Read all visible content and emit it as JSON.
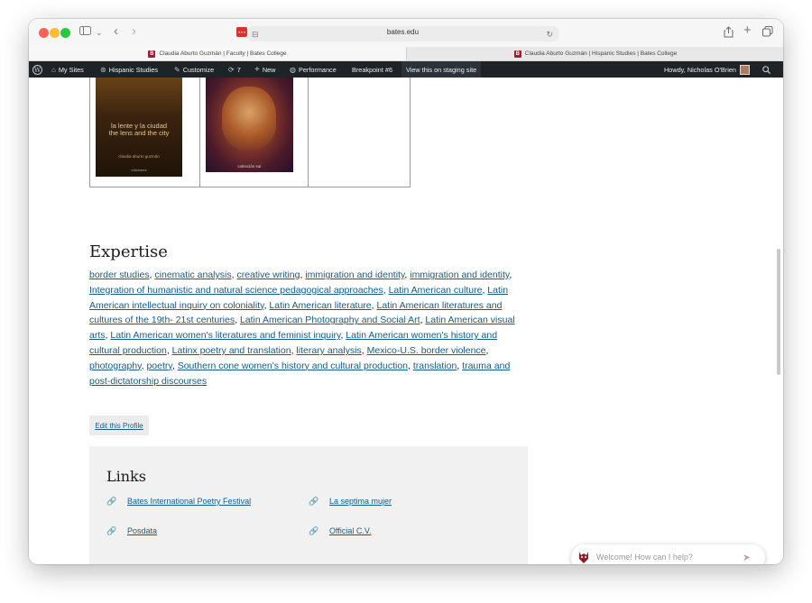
{
  "browser": {
    "url": "bates.edu",
    "tabs": [
      {
        "label": "Claudia Aburto Guzmán | Faculty | Bates College",
        "favicon": "B",
        "active": true
      },
      {
        "label": "Claudia Aburto Guzmán | Hispanic Studies | Bates College",
        "favicon": "B",
        "active": false
      }
    ],
    "icons": {
      "sidebar": "sidebar-icon",
      "back": "‹",
      "forward": "›",
      "share": "share-icon",
      "new_tab": "+",
      "tabs": "tabs-icon",
      "reload": "↻"
    }
  },
  "admin_bar": {
    "my_sites": "My Sites",
    "site_name": "Hispanic Studies",
    "customize": "Customize",
    "updates_count": "7",
    "new": "New",
    "performance": "Performance",
    "breakpoint": "Breakpoint #6",
    "staging": "View this on staging site",
    "howdy": "Howdy, Nicholas O'Brien"
  },
  "books": [
    {
      "title_es": "la lente y la ciudad",
      "title_en": "the lens and the city",
      "author": "claudia aburto guzmán",
      "publisher": "ediciones"
    },
    {
      "caption": "colección sur"
    }
  ],
  "expertise": {
    "heading": "Expertise",
    "tags": [
      "border studies",
      "cinematic analysis",
      "creative writing",
      "immigration and identity",
      "immigration and identity",
      "Integration of humanistic and natural science pedagogical approaches",
      "Latin American culture",
      "Latin American intellectual inquiry on coloniality",
      "Latin American literature",
      "Latin American literatures and cultures of the 19th- 21st centuries",
      "Latin American Photography and Social Art",
      "Latin American visual arts",
      "Latin American women's literatures and feminist inquiry",
      "Latin American women's history and cultural production",
      "Latinx poetry and translation",
      "literary analysis",
      "Mexico-U.S. border violence",
      "photography",
      "poetry",
      "Southern cone women's history and cultural production",
      "translation",
      "trauma and post-dictatorship discourses"
    ],
    "separator": ", "
  },
  "edit_profile": "Edit this Profile",
  "links": {
    "heading": "Links",
    "items": [
      {
        "label": "Bates International Poetry Festival"
      },
      {
        "label": "La septima mujer"
      },
      {
        "label": "Posdata"
      },
      {
        "label": "Official C.V."
      }
    ]
  },
  "chat": {
    "placeholder": "Welcome! How can I help?"
  },
  "colors": {
    "link": "#155b87",
    "admin_bar": "#1d2327",
    "brand": "#a6192e",
    "links_bg": "#f1f1f1"
  }
}
